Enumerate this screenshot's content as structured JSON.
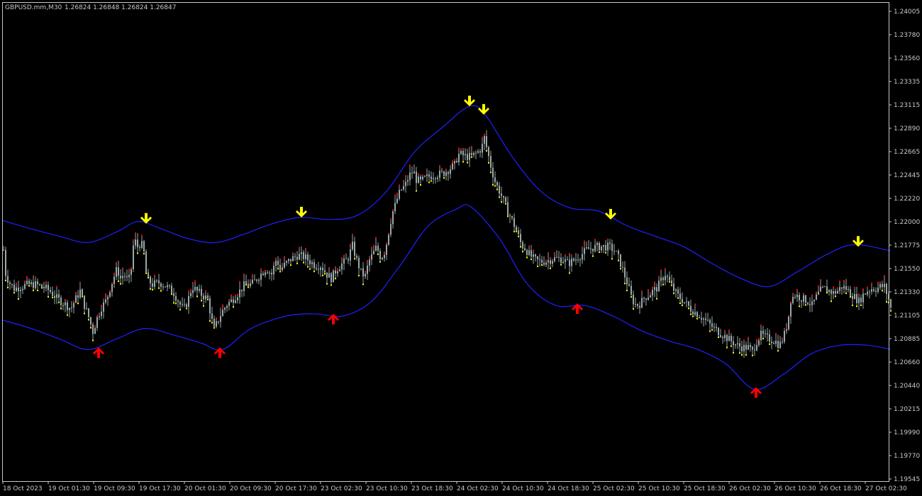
{
  "header": {
    "symbol": "GBPUSD.mm,M30",
    "ohlc": "1.26824 1.26848 1.26824 1.26847"
  },
  "chart_data": {
    "type": "line",
    "title": "GBPUSD.mm,M30",
    "y_ticks": [
      "1.24005",
      "1.23780",
      "1.23560",
      "1.23335",
      "1.23115",
      "1.22890",
      "1.22665",
      "1.22445",
      "1.22220",
      "1.22000",
      "1.21775",
      "1.21550",
      "1.21330",
      "1.21105",
      "1.20885",
      "1.20660",
      "1.20440",
      "1.20215",
      "1.19990",
      "1.19770",
      "1.19545"
    ],
    "ylim": [
      1.19545,
      1.24005
    ],
    "x_labels": [
      "18 Oct 2023",
      "19 Oct 01:30",
      "19 Oct 09:30",
      "19 Oct 17:30",
      "20 Oct 01:30",
      "20 Oct 09:30",
      "20 Oct 17:30",
      "23 Oct 02:30",
      "23 Oct 10:30",
      "23 Oct 18:30",
      "24 Oct 02:30",
      "24 Oct 10:30",
      "24 Oct 18:30",
      "25 Oct 02:30",
      "25 Oct 10:30",
      "25 Oct 18:30",
      "26 Oct 02:30",
      "26 Oct 10:30",
      "26 Oct 18:30",
      "27 Oct 02:30"
    ],
    "price_path": [
      [
        0,
        1.2173
      ],
      [
        3,
        1.215
      ],
      [
        8,
        1.2142
      ],
      [
        15,
        1.2136
      ],
      [
        25,
        1.2138
      ],
      [
        35,
        1.214
      ],
      [
        45,
        1.214
      ],
      [
        55,
        1.2138
      ],
      [
        65,
        1.2134
      ],
      [
        75,
        1.2127
      ],
      [
        85,
        1.2122
      ],
      [
        95,
        1.2117
      ],
      [
        100,
        1.2124
      ],
      [
        108,
        1.2134
      ],
      [
        113,
        1.2122
      ],
      [
        120,
        1.2109
      ],
      [
        126,
        1.2095
      ],
      [
        132,
        1.2108
      ],
      [
        138,
        1.2118
      ],
      [
        145,
        1.2125
      ],
      [
        150,
        1.2136
      ],
      [
        155,
        1.2146
      ],
      [
        160,
        1.2155
      ],
      [
        165,
        1.2146
      ],
      [
        170,
        1.215
      ],
      [
        176,
        1.2142
      ],
      [
        180,
        1.2155
      ],
      [
        184,
        1.2184
      ],
      [
        189,
        1.2176
      ],
      [
        194,
        1.218
      ],
      [
        198,
        1.217
      ],
      [
        202,
        1.2145
      ],
      [
        210,
        1.214
      ],
      [
        220,
        1.2142
      ],
      [
        230,
        1.2138
      ],
      [
        240,
        1.2132
      ],
      [
        248,
        1.2122
      ],
      [
        254,
        1.2116
      ],
      [
        260,
        1.2125
      ],
      [
        266,
        1.2138
      ],
      [
        272,
        1.2134
      ],
      [
        280,
        1.213
      ],
      [
        288,
        1.2126
      ],
      [
        293,
        1.2108
      ],
      [
        297,
        1.2097
      ],
      [
        302,
        1.2105
      ],
      [
        308,
        1.2114
      ],
      [
        315,
        1.2121
      ],
      [
        322,
        1.2125
      ],
      [
        330,
        1.2131
      ],
      [
        340,
        1.214
      ],
      [
        350,
        1.214
      ],
      [
        360,
        1.2148
      ],
      [
        370,
        1.2155
      ],
      [
        378,
        1.215
      ],
      [
        385,
        1.2165
      ],
      [
        390,
        1.2154
      ],
      [
        398,
        1.216
      ],
      [
        405,
        1.2164
      ],
      [
        415,
        1.2168
      ],
      [
        425,
        1.2166
      ],
      [
        432,
        1.2162
      ],
      [
        440,
        1.2158
      ],
      [
        448,
        1.2158
      ],
      [
        455,
        1.215
      ],
      [
        462,
        1.2146
      ],
      [
        470,
        1.2155
      ],
      [
        478,
        1.216
      ],
      [
        485,
        1.2164
      ],
      [
        492,
        1.2177
      ],
      [
        497,
        1.2165
      ],
      [
        505,
        1.215
      ],
      [
        510,
        1.2148
      ],
      [
        515,
        1.2162
      ],
      [
        520,
        1.2168
      ],
      [
        526,
        1.2176
      ],
      [
        532,
        1.2165
      ],
      [
        538,
        1.2172
      ],
      [
        543,
        1.219
      ],
      [
        548,
        1.2208
      ],
      [
        552,
        1.2215
      ],
      [
        556,
        1.2224
      ],
      [
        560,
        1.223
      ],
      [
        566,
        1.2234
      ],
      [
        572,
        1.2244
      ],
      [
        578,
        1.2248
      ],
      [
        582,
        1.224
      ],
      [
        588,
        1.2238
      ],
      [
        596,
        1.2242
      ],
      [
        604,
        1.2244
      ],
      [
        612,
        1.2245
      ],
      [
        620,
        1.2246
      ],
      [
        628,
        1.225
      ],
      [
        636,
        1.2254
      ],
      [
        641,
        1.2264
      ],
      [
        645,
        1.2264
      ],
      [
        652,
        1.2262
      ],
      [
        660,
        1.2262
      ],
      [
        668,
        1.2266
      ],
      [
        674,
        1.227
      ],
      [
        678,
        1.228
      ],
      [
        682,
        1.2268
      ],
      [
        688,
        1.225
      ],
      [
        694,
        1.2236
      ],
      [
        700,
        1.2228
      ],
      [
        706,
        1.2218
      ],
      [
        712,
        1.2208
      ],
      [
        718,
        1.22
      ],
      [
        724,
        1.219
      ],
      [
        730,
        1.2178
      ],
      [
        736,
        1.2174
      ],
      [
        742,
        1.2168
      ],
      [
        748,
        1.2164
      ],
      [
        756,
        1.2162
      ],
      [
        764,
        1.2162
      ],
      [
        772,
        1.2164
      ],
      [
        780,
        1.2165
      ],
      [
        788,
        1.2164
      ],
      [
        796,
        1.216
      ],
      [
        806,
        1.2164
      ],
      [
        814,
        1.2168
      ],
      [
        822,
        1.2173
      ],
      [
        830,
        1.2175
      ],
      [
        838,
        1.2176
      ],
      [
        846,
        1.2176
      ],
      [
        854,
        1.2176
      ],
      [
        862,
        1.2172
      ],
      [
        868,
        1.2164
      ],
      [
        874,
        1.2152
      ],
      [
        880,
        1.214
      ],
      [
        886,
        1.2126
      ],
      [
        892,
        1.212
      ],
      [
        898,
        1.2122
      ],
      [
        904,
        1.2128
      ],
      [
        910,
        1.213
      ],
      [
        916,
        1.2134
      ],
      [
        922,
        1.2137
      ],
      [
        928,
        1.2145
      ],
      [
        933,
        1.215
      ],
      [
        938,
        1.2144
      ],
      [
        944,
        1.2136
      ],
      [
        950,
        1.213
      ],
      [
        956,
        1.2126
      ],
      [
        962,
        1.2122
      ],
      [
        970,
        1.2116
      ],
      [
        978,
        1.2112
      ],
      [
        986,
        1.2108
      ],
      [
        994,
        1.2103
      ],
      [
        1002,
        1.2098
      ],
      [
        1010,
        1.2094
      ],
      [
        1018,
        1.209
      ],
      [
        1026,
        1.2086
      ],
      [
        1034,
        1.2082
      ],
      [
        1042,
        1.208
      ],
      [
        1050,
        1.208
      ],
      [
        1056,
        1.2076
      ],
      [
        1062,
        1.2086
      ],
      [
        1068,
        1.2092
      ],
      [
        1074,
        1.209
      ],
      [
        1080,
        1.2088
      ],
      [
        1088,
        1.2086
      ],
      [
        1094,
        1.2082
      ],
      [
        1100,
        1.209
      ],
      [
        1106,
        1.2105
      ],
      [
        1110,
        1.2126
      ],
      [
        1116,
        1.213
      ],
      [
        1122,
        1.2128
      ],
      [
        1128,
        1.2126
      ],
      [
        1134,
        1.2124
      ],
      [
        1140,
        1.212
      ],
      [
        1146,
        1.2128
      ],
      [
        1152,
        1.2134
      ],
      [
        1158,
        1.2136
      ],
      [
        1164,
        1.2134
      ],
      [
        1170,
        1.2132
      ],
      [
        1176,
        1.2134
      ],
      [
        1182,
        1.2138
      ],
      [
        1188,
        1.2136
      ],
      [
        1194,
        1.2132
      ],
      [
        1200,
        1.2128
      ],
      [
        1206,
        1.2124
      ],
      [
        1212,
        1.213
      ],
      [
        1218,
        1.2134
      ],
      [
        1224,
        1.2136
      ],
      [
        1230,
        1.2136
      ],
      [
        1236,
        1.2138
      ],
      [
        1242,
        1.2138
      ],
      [
        1248,
        1.2126
      ],
      [
        1252,
        1.2114
      ]
    ],
    "upper_band": [
      [
        0,
        1.2201
      ],
      [
        40,
        1.2193
      ],
      [
        80,
        1.2186
      ],
      [
        120,
        1.218
      ],
      [
        160,
        1.219
      ],
      [
        190,
        1.22
      ],
      [
        220,
        1.2194
      ],
      [
        260,
        1.2184
      ],
      [
        300,
        1.218
      ],
      [
        340,
        1.2188
      ],
      [
        380,
        1.2198
      ],
      [
        420,
        1.2204
      ],
      [
        460,
        1.2202
      ],
      [
        500,
        1.2206
      ],
      [
        540,
        1.2228
      ],
      [
        580,
        1.2266
      ],
      [
        620,
        1.229
      ],
      [
        658,
        1.231
      ],
      [
        680,
        1.2302
      ],
      [
        720,
        1.226
      ],
      [
        760,
        1.2228
      ],
      [
        800,
        1.2213
      ],
      [
        840,
        1.221
      ],
      [
        880,
        1.2196
      ],
      [
        920,
        1.2186
      ],
      [
        960,
        1.2176
      ],
      [
        1000,
        1.216
      ],
      [
        1040,
        1.2146
      ],
      [
        1080,
        1.2138
      ],
      [
        1120,
        1.2152
      ],
      [
        1160,
        1.2168
      ],
      [
        1200,
        1.2178
      ],
      [
        1252,
        1.2172
      ]
    ],
    "lower_band": [
      [
        0,
        1.2106
      ],
      [
        40,
        1.2098
      ],
      [
        80,
        1.2088
      ],
      [
        120,
        1.2078
      ],
      [
        160,
        1.2088
      ],
      [
        200,
        1.2098
      ],
      [
        240,
        1.2092
      ],
      [
        280,
        1.2084
      ],
      [
        310,
        1.2078
      ],
      [
        350,
        1.2098
      ],
      [
        400,
        1.211
      ],
      [
        440,
        1.2112
      ],
      [
        480,
        1.211
      ],
      [
        520,
        1.2124
      ],
      [
        560,
        1.2158
      ],
      [
        600,
        1.2196
      ],
      [
        640,
        1.2212
      ],
      [
        660,
        1.2214
      ],
      [
        700,
        1.2184
      ],
      [
        740,
        1.214
      ],
      [
        780,
        1.212
      ],
      [
        820,
        1.212
      ],
      [
        860,
        1.211
      ],
      [
        900,
        1.2096
      ],
      [
        940,
        1.2086
      ],
      [
        980,
        1.2078
      ],
      [
        1020,
        1.2064
      ],
      [
        1060,
        1.204
      ],
      [
        1100,
        1.2054
      ],
      [
        1140,
        1.2074
      ],
      [
        1180,
        1.2082
      ],
      [
        1220,
        1.2082
      ],
      [
        1252,
        1.2078
      ]
    ],
    "sell_arrows": [
      [
        202,
        1.2202
      ],
      [
        421,
        1.2208
      ],
      [
        658,
        1.2314
      ],
      [
        678,
        1.2306
      ],
      [
        857,
        1.2206
      ],
      [
        1206,
        1.218
      ]
    ],
    "buy_arrows": [
      [
        135,
        1.2076
      ],
      [
        306,
        1.2076
      ],
      [
        466,
        1.2108
      ],
      [
        810,
        1.2118
      ],
      [
        1062,
        1.2038
      ]
    ],
    "colors": {
      "background": "#000000",
      "bands": "#2020ff",
      "candles": "#9aa9a9",
      "sell": "#ffff00",
      "buy": "#ff0000",
      "axis": "#c8c8c8"
    }
  }
}
